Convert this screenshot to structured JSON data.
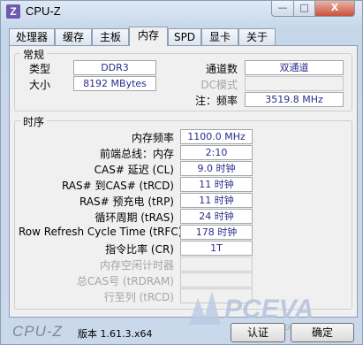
{
  "window": {
    "title": "CPU-Z",
    "icon_letter": "Z",
    "minimize": "—",
    "maximize": "□",
    "close": "X"
  },
  "tabs": [
    {
      "label": "处理器"
    },
    {
      "label": "缓存"
    },
    {
      "label": "主板"
    },
    {
      "label": "内存",
      "active": true
    },
    {
      "label": "SPD"
    },
    {
      "label": "显卡"
    },
    {
      "label": "关于"
    }
  ],
  "general": {
    "group_label": "常规",
    "type_label": "类型",
    "type_value": "DDR3",
    "size_label": "大小",
    "size_value": "8192 MBytes",
    "channels_label": "通道数",
    "channels_value": "双通道",
    "dc_mode_label": "DC模式",
    "dc_mode_value": "",
    "nb_freq_label": "注：频率",
    "nb_freq_value": "3519.8 MHz"
  },
  "timings": {
    "group_label": "时序",
    "rows": [
      {
        "label": "内存频率",
        "value": "1100.0 MHz",
        "enabled": true
      },
      {
        "label": "前端总线：内存",
        "value": "2:10",
        "enabled": true
      },
      {
        "label": "CAS# 延迟 (CL)",
        "value": "9.0 时钟",
        "enabled": true
      },
      {
        "label": "RAS# 到CAS# (tRCD)",
        "value": "11 时钟",
        "enabled": true
      },
      {
        "label": "RAS# 预充电 (tRP)",
        "value": "11 时钟",
        "enabled": true
      },
      {
        "label": "循环周期 (tRAS)",
        "value": "24 时钟",
        "enabled": true
      },
      {
        "label": "Row Refresh Cycle Time (tRFC)",
        "value": "178 时钟",
        "enabled": true
      },
      {
        "label": "指令比率 (CR)",
        "value": "1T",
        "enabled": true
      },
      {
        "label": "内存空闲计时器",
        "value": "",
        "enabled": false
      },
      {
        "label": "总CAS号 (tRDRAM)",
        "value": "",
        "enabled": false
      },
      {
        "label": "行至列 (tRCD)",
        "value": "",
        "enabled": false
      }
    ]
  },
  "footer": {
    "brand": "CPU-Z",
    "version": "版本 1.61.3.x64",
    "validate_label": "认证",
    "ok_label": "确定",
    "watermark": "PCEVA",
    "watermark_url": "CEVA.com"
  }
}
